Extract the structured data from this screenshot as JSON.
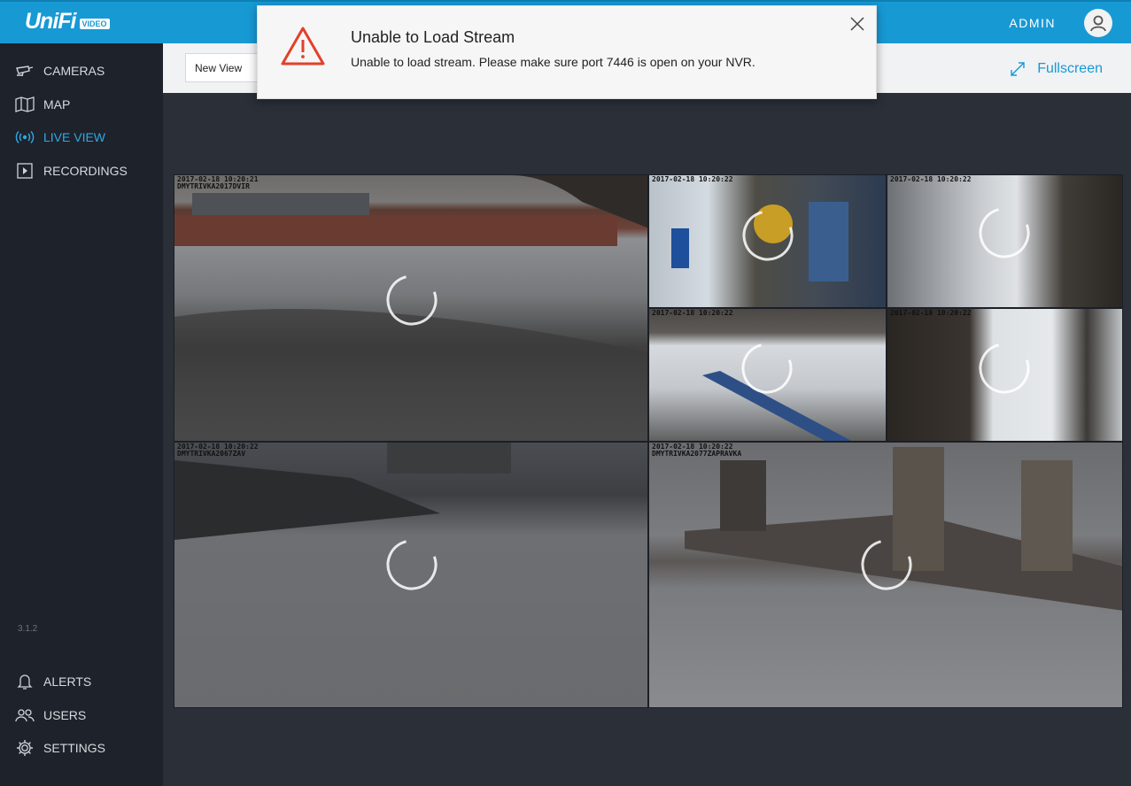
{
  "app": {
    "logo_text": "UniFi",
    "logo_badge": "VIDEO",
    "user_label": "ADMIN"
  },
  "sidebar": {
    "items": [
      {
        "label": "CAMERAS",
        "icon": "camera-icon"
      },
      {
        "label": "MAP",
        "icon": "map-icon"
      },
      {
        "label": "LIVE VIEW",
        "icon": "live-view-icon",
        "active": true
      },
      {
        "label": "RECORDINGS",
        "icon": "play-icon"
      }
    ],
    "version": "3.1.2",
    "bottom_items": [
      {
        "label": "ALERTS",
        "icon": "bell-icon"
      },
      {
        "label": "USERS",
        "icon": "users-icon"
      },
      {
        "label": "SETTINGS",
        "icon": "gear-icon"
      }
    ]
  },
  "subheader": {
    "view_value": "New View",
    "fullscreen_label": "Fullscreen"
  },
  "cameras": [
    {
      "timestamp": "2017-02-18 10:20:21\nDMYTRIVKA2017DVIR"
    },
    {
      "timestamp": "2017-02-18 10:20:22"
    },
    {
      "timestamp": "2017-02-18 10:20:22"
    },
    {
      "timestamp": "2017-02-18 10:20:22"
    },
    {
      "timestamp": "2017-02-18 10:20:22"
    },
    {
      "timestamp": "2017-02-18 10:20:22\nDMYTRIVKA2067ZAV"
    },
    {
      "timestamp": "2017-02-18 10:20:22\nDMYTRIVKA2077ZAPRAVKA"
    }
  ],
  "modal": {
    "title": "Unable to Load Stream",
    "message": "Unable to load stream. Please make sure port 7446 is open on your NVR."
  },
  "colors": {
    "accent": "#1799d4",
    "sidebar_bg": "#1e222a",
    "content_bg": "#2a2f38",
    "warning": "#e2402b"
  }
}
